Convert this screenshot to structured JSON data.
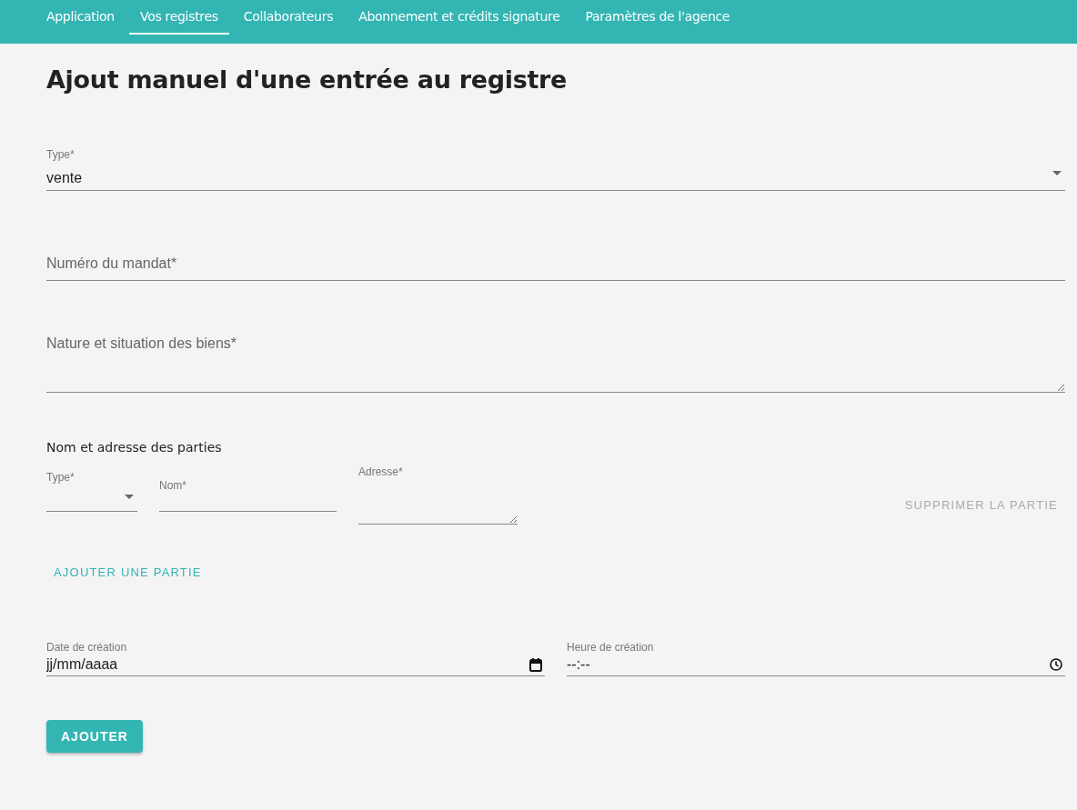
{
  "nav": {
    "tabs": [
      {
        "label": "Application",
        "selected": false
      },
      {
        "label": "Vos registres",
        "selected": true
      },
      {
        "label": "Collaborateurs",
        "selected": false
      },
      {
        "label": "Abonnement et crédits signature",
        "selected": false
      },
      {
        "label": "Paramètres de l'agence",
        "selected": false
      }
    ]
  },
  "title": "Ajout manuel d'une entrée au registre",
  "type_field": {
    "label": "Type*",
    "value": "vente"
  },
  "mandate_field": {
    "placeholder": "Numéro du mandat*"
  },
  "nature_field": {
    "placeholder": "Nature et situation des biens*"
  },
  "parties": {
    "heading": "Nom et adresse des parties",
    "rows": [
      {
        "type_label": "Type*",
        "name_label": "Nom*",
        "address_label": "Adresse*",
        "remove": {
          "label": "SUPPRIMER LA PARTIE",
          "disabled": true
        }
      }
    ],
    "add_label": "AJOUTER UNE PARTIE"
  },
  "date_field": {
    "label": "Date de création",
    "placeholder": "jj/mm/aaaa"
  },
  "time_field": {
    "label": "Heure de création",
    "placeholder": "--:--"
  },
  "submit": {
    "label": "AJOUTER"
  }
}
